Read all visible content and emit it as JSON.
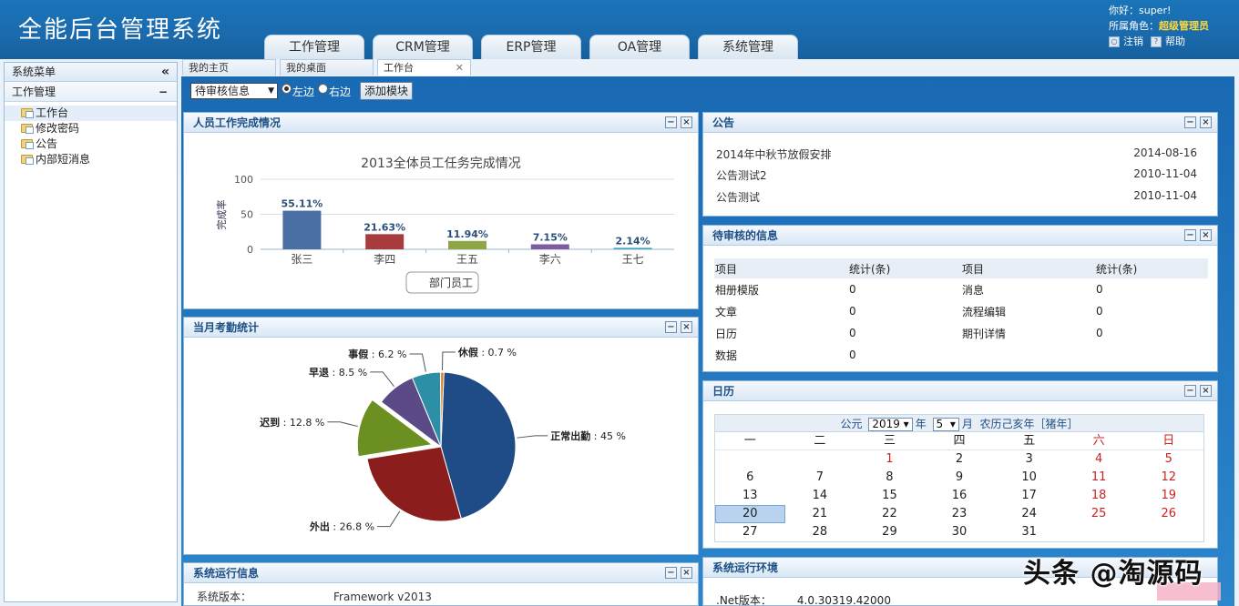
{
  "header": {
    "title": "全能后台管理系统",
    "tabs": [
      "工作管理",
      "CRM管理",
      "ERP管理",
      "OA管理",
      "系统管理"
    ],
    "greeting": "你好：super!",
    "role_label": "所属角色：",
    "role_value": "超级管理员",
    "logout": "注销",
    "help": "帮助"
  },
  "sidebar": {
    "title": "系统菜单",
    "collapse_icon": "«",
    "group": "工作管理",
    "group_toggle": "−",
    "items": [
      "工作台",
      "修改密码",
      "公告",
      "内部短消息"
    ]
  },
  "page_tabs": [
    "我的主页",
    "我的桌面",
    "工作台"
  ],
  "toolbar": {
    "select_value": "待审核信息",
    "radio_left": "左边",
    "radio_right": "右边",
    "add_button": "添加模块"
  },
  "panels": {
    "work": {
      "title": "人员工作完成情况",
      "button": "部门员工"
    },
    "attendance": {
      "title": "当月考勤统计"
    },
    "sysrun": {
      "title": "系统运行信息",
      "row_label": "系统版本：",
      "row_value": "Framework v2013"
    },
    "announcement": {
      "title": "公告",
      "rows": [
        {
          "text": "2014年中秋节放假安排",
          "date": "2014-08-16"
        },
        {
          "text": "公告测试2",
          "date": "2010-11-04"
        },
        {
          "text": "公告测试",
          "date": "2010-11-04"
        }
      ]
    },
    "pending": {
      "title": "待审核的信息",
      "headers": [
        "项目",
        "统计(条)",
        "项目",
        "统计(条)"
      ],
      "rows": [
        [
          "相册模版",
          "0",
          "消息",
          "0"
        ],
        [
          "文章",
          "0",
          "流程编辑",
          "0"
        ],
        [
          "日历",
          "0",
          "期刊详情",
          "0"
        ],
        [
          "数据",
          "0",
          "",
          ""
        ]
      ]
    },
    "calendar": {
      "title": "日历",
      "era": "公元",
      "year": "2019",
      "year_unit": "年",
      "month": "5",
      "month_unit": "月",
      "lunar": "农历己亥年［猪年］",
      "weekdays": [
        "一",
        "二",
        "三",
        "四",
        "五",
        "六",
        "日"
      ],
      "weeks": [
        [
          "",
          "",
          "1",
          "2",
          "3",
          "4",
          "5"
        ],
        [
          "6",
          "7",
          "8",
          "9",
          "10",
          "11",
          "12"
        ],
        [
          "13",
          "14",
          "15",
          "16",
          "17",
          "18",
          "19"
        ],
        [
          "20",
          "21",
          "22",
          "23",
          "24",
          "25",
          "26"
        ],
        [
          "27",
          "28",
          "29",
          "30",
          "31",
          "",
          ""
        ]
      ],
      "today": "20"
    },
    "env": {
      "title": "系统运行环境",
      "label": ".Net版本：",
      "value": "4.0.30319.42000"
    }
  },
  "watermark": "头条 @淘源码",
  "colors": {
    "bar_blue": "#4a6fa5",
    "bar_red": "#a83c3c",
    "bar_green": "#8ea647",
    "bar_purple": "#7e5ca0",
    "bar_teal": "#3da7b6"
  },
  "chart_data": [
    {
      "type": "bar",
      "title": "2013全体员工任务完成情况",
      "ylabel": "完成率",
      "ylim": [
        0,
        100
      ],
      "yticks": [
        0,
        50,
        100
      ],
      "categories": [
        "张三",
        "李四",
        "王五",
        "李六",
        "王七"
      ],
      "values": [
        55.11,
        21.63,
        11.94,
        7.15,
        2.14
      ],
      "labels": [
        "55.11%",
        "21.63%",
        "11.94%",
        "7.15%",
        "2.14%"
      ],
      "colors": [
        "#4a6fa5",
        "#a83c3c",
        "#8ea647",
        "#7e5ca0",
        "#3da7b6"
      ]
    },
    {
      "type": "pie",
      "slices": [
        {
          "name": "正常出勤",
          "value": 45,
          "label": "45 %",
          "color": "#1f4b86"
        },
        {
          "name": "外出",
          "value": 26.8,
          "label": "26.8 %",
          "color": "#8b1d1d"
        },
        {
          "name": "迟到",
          "value": 12.8,
          "label": "12.8 %",
          "color": "#6c8f22"
        },
        {
          "name": "早退",
          "value": 8.5,
          "label": "8.5 %",
          "color": "#5b4a86"
        },
        {
          "name": "事假",
          "value": 6.2,
          "label": "6.2 %",
          "color": "#2c8fa5"
        },
        {
          "name": "休假",
          "value": 0.7,
          "label": "0.7 %",
          "color": "#e07b1c"
        }
      ]
    }
  ]
}
